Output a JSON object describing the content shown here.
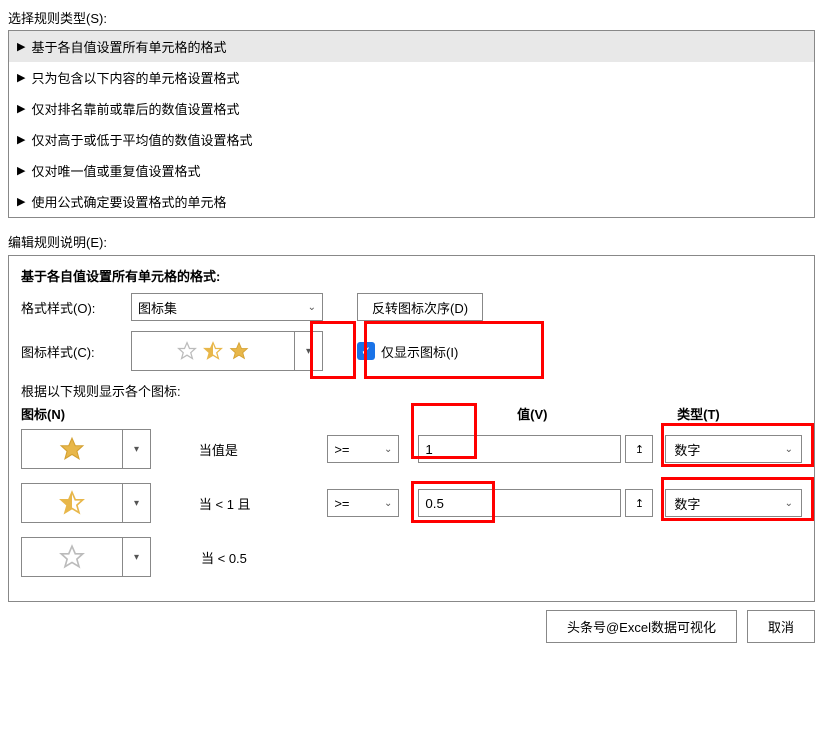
{
  "header": {
    "select_rule_label": "选择规则类型(S):"
  },
  "rules": [
    "基于各自值设置所有单元格的格式",
    "只为包含以下内容的单元格设置格式",
    "仅对排名靠前或靠后的数值设置格式",
    "仅对高于或低于平均值的数值设置格式",
    "仅对唯一值或重复值设置格式",
    "使用公式确定要设置格式的单元格"
  ],
  "edit": {
    "label": "编辑规则说明(E):",
    "title": "基于各自值设置所有单元格的格式:",
    "format_style_label": "格式样式(O):",
    "format_style_value": "图标集",
    "reverse_btn": "反转图标次序(D)",
    "icon_style_label": "图标样式(C):",
    "show_icon_only": "仅显示图标(I)",
    "rule_display_label": "根据以下规则显示各个图标:",
    "icon_header": "图标(N)",
    "value_header": "值(V)",
    "type_header": "类型(T)",
    "rows": [
      {
        "cond": "当值是",
        "op": ">=",
        "val": "1",
        "type": "数字"
      },
      {
        "cond": "当 < 1 且",
        "op": ">=",
        "val": "0.5",
        "type": "数字"
      },
      {
        "cond": "当 < 0.5",
        "op": "",
        "val": "",
        "type": ""
      }
    ]
  },
  "footer": {
    "text1": "头条号@Excel数据可视化",
    "cancel": "取消"
  }
}
